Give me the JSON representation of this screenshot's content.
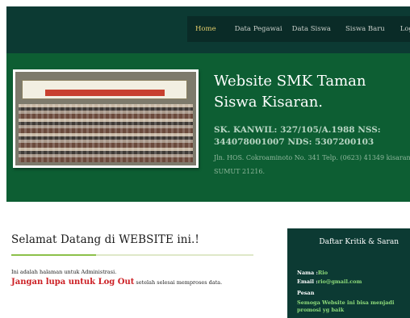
{
  "nav": {
    "items": [
      {
        "label": "Home",
        "active": true
      },
      {
        "label": "Data Pegawai"
      },
      {
        "label": "Data Siswa"
      },
      {
        "label": "Siswa Baru"
      },
      {
        "label": "Log Out"
      }
    ]
  },
  "hero": {
    "title": "Website SMK Taman Siswa Kisaran.",
    "sk": "SK. KANWIL: 327/105/A.1988 NSS: 344078001007 NDS: 5307200103",
    "address": "Jln. HOS. Cokroaminoto No. 341 Telp. (0623) 41349 kisaran SUMUT 21216.",
    "photo_banner": "SMKS TAMAN SISWA KISARAN",
    "photo_banner_top": "TAMAN KARYA MADYA EKONOMI"
  },
  "welcome": {
    "title": "Selamat Datang di WEBSITE ini.!",
    "line1": "Ini adalah halaman untuk Administrasi.",
    "warning": "Jangan lupa untuk Log Out",
    "line2_rest": " setelah selesai memproses data."
  },
  "sidebar": {
    "title": "Daftar Kritik & Saran",
    "nama_label": "Nama  :",
    "nama_value": "Rio",
    "email_label": "Email  :",
    "email_value": "rio@gmail.com",
    "pesan_label": "Pesan",
    "message": "Semoga Website ini bisa menjadi promosi yg baik"
  },
  "colors": {
    "nav_bg": "#0c3a33",
    "hero_bg": "#0d5e33",
    "active_nav": "#e2cc6a",
    "warning": "#cc1f24",
    "sidebar_value": "#8fdc7a"
  }
}
